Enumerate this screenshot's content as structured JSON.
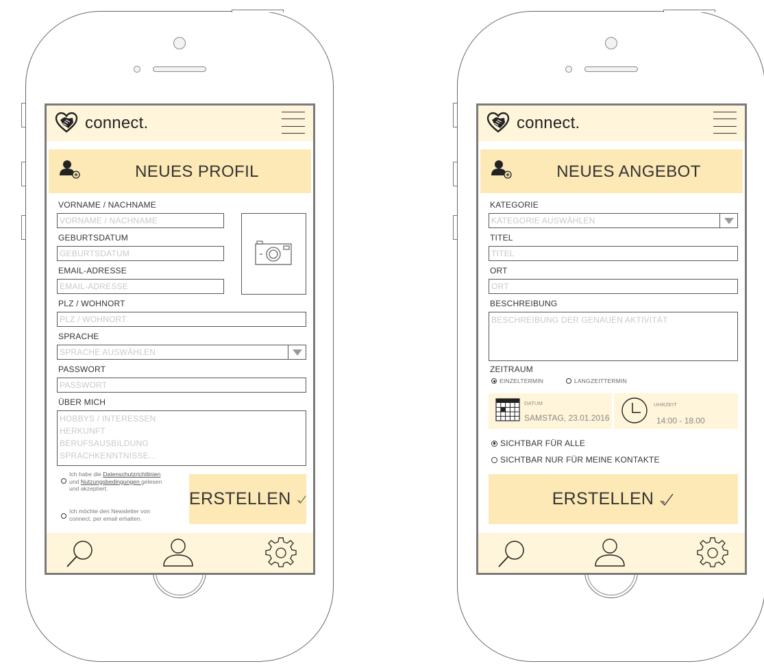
{
  "brand": {
    "app_name": "connect."
  },
  "profile_screen": {
    "title": "NEUES PROFIL",
    "name_label": "VORNAME / NACHNAME",
    "name_placeholder": "VORNAME / NACHNAME",
    "birth_label": "GEBURTSDATUM",
    "birth_placeholder": "GEBURTSDATUM",
    "email_label": "EMAIL-ADRESSE",
    "email_placeholder": "EMAIL-ADRESSE",
    "zip_label": "PLZ / WOHNORT",
    "zip_placeholder": "PLZ / WOHNORT",
    "language_label": "SPRACHE",
    "language_placeholder": "SPRACHE AUSWÄHLEN",
    "password_label": "PASSWORT",
    "password_placeholder": "PASSWORT",
    "about_label": "ÜBER MICH",
    "about_placeholder_lines": [
      "HOBBYS / INTERESSEN",
      "HERKUNFT",
      "BERUFSAUSBILDUNG",
      "SPRACHKENNTNISSE..."
    ],
    "privacy_check": {
      "part1": "Ich habe die ",
      "link1": "Datenschutzrichtlinien",
      "part2": "und ",
      "link2": "Nutzungsbedingungen ",
      "part3": "gelesen",
      "part4": "und akzeptiert."
    },
    "newsletter_check": {
      "line1": "Ich möchte den Newsletter von",
      "line2": "connect. per email erhalten."
    },
    "create_label": "ERSTELLEN"
  },
  "offer_screen": {
    "title": "NEUES ANGEBOT",
    "category_label": "KATEGORIE",
    "category_placeholder": "KATEGORIE AUSWÄHLEN",
    "title_label": "TITEL",
    "title_placeholder": "TITEL",
    "place_label": "ORT",
    "place_placeholder": "ORT",
    "description_label": "BESCHREIBUNG",
    "description_placeholder": "BESCHREIBUNG DER GENAUEN AKTIVITÄT",
    "period_label": "ZEITRAUM",
    "period_options": [
      "EINZELTERMIN",
      "LANGZEITTERMIN"
    ],
    "period_selected": "EINZELTERMIN",
    "date_caption": "DATUM",
    "date_value": "SAMSTAG, 23.01.2016",
    "time_caption": "UHRZEIT",
    "time_value": "14:00 - 18.00",
    "visibility_options": [
      "SICHTBAR FÜR ALLE",
      "SICHTBAR NUR FÜR MEINE KONTAKTE"
    ],
    "visibility_selected": "SICHTBAR FÜR ALLE",
    "create_label": "ERSTELLEN"
  },
  "icons": [
    "handshake-heart-icon",
    "hamburger-menu-icon",
    "add-user-icon",
    "camera-icon",
    "checkmark-icon",
    "calendar-icon",
    "clock-icon",
    "search-icon",
    "profile-icon",
    "settings-gear-icon"
  ]
}
